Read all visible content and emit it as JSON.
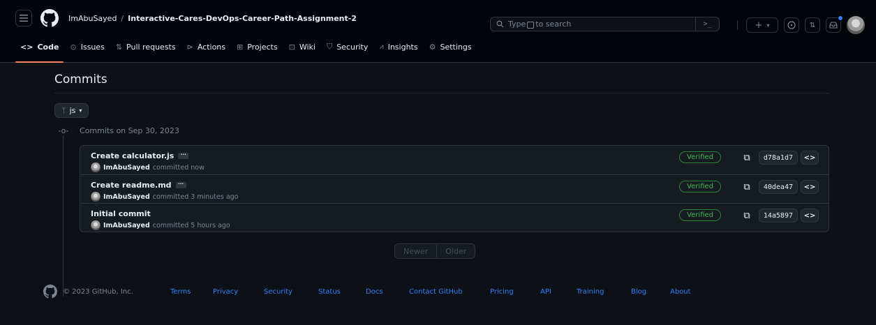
{
  "header": {
    "owner": "ImAbuSayed",
    "separator": "/",
    "repo": "Interactive-Cares-DevOps-Career-Path-Assignment-2",
    "search_before": "Type",
    "search_key": "/",
    "search_after": "to search",
    "command_palette": ">_"
  },
  "tabs": [
    {
      "label": "Code",
      "icon": "code-icon"
    },
    {
      "label": "Issues",
      "icon": "issue-icon"
    },
    {
      "label": "Pull requests",
      "icon": "pull-request-icon"
    },
    {
      "label": "Actions",
      "icon": "play-icon"
    },
    {
      "label": "Projects",
      "icon": "table-icon"
    },
    {
      "label": "Wiki",
      "icon": "book-icon"
    },
    {
      "label": "Security",
      "icon": "shield-icon"
    },
    {
      "label": "Insights",
      "icon": "graph-icon"
    },
    {
      "label": "Settings",
      "icon": "gear-icon"
    }
  ],
  "main": {
    "title": "Commits",
    "branch": "js",
    "group_label": "Commits on Sep 30, 2023"
  },
  "commits": [
    {
      "message": "Create calculator.js",
      "author": "ImAbuSayed",
      "time": "committed now",
      "badge": "Verified",
      "sha": "d78a1d7"
    },
    {
      "message": "Create readme.md",
      "author": "ImAbuSayed",
      "time": "committed 3 minutes ago",
      "badge": "Verified",
      "sha": "40dea47"
    },
    {
      "message": "Initial commit",
      "author": "ImAbuSayed",
      "time": "committed 5 hours ago",
      "badge": "Verified",
      "sha": "14a5897"
    }
  ],
  "pager": {
    "newer": "Newer",
    "older": "Older"
  },
  "footer": {
    "copyright": "© 2023 GitHub, Inc.",
    "links": [
      "Terms",
      "Privacy",
      "Security",
      "Status",
      "Docs",
      "Contact GitHub",
      "Pricing",
      "API",
      "Training",
      "Blog",
      "About"
    ]
  },
  "colors": {
    "accent": "#2f81f7",
    "verified": "#3fb950",
    "tab_underline": "#f78166"
  }
}
